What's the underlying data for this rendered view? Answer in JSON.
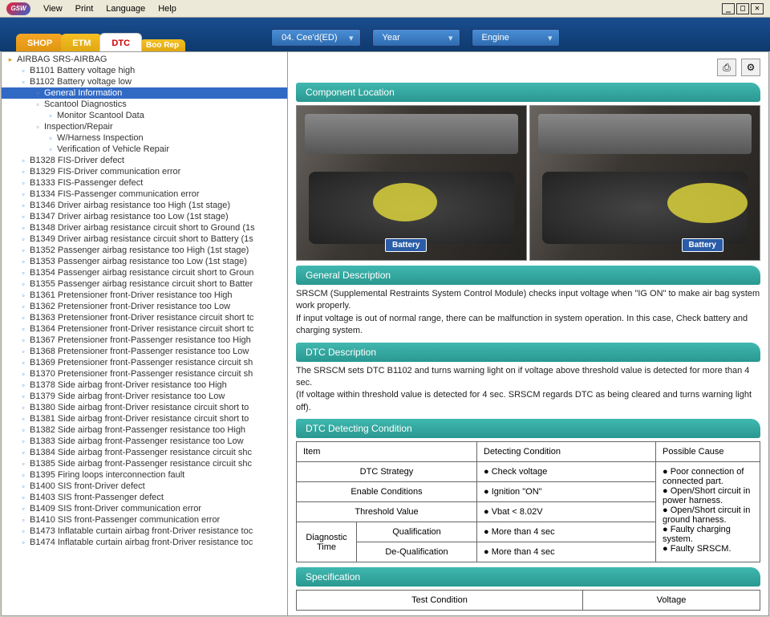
{
  "menu": {
    "view": "View",
    "print": "Print",
    "language": "Language",
    "help": "Help",
    "logo": "GSW"
  },
  "tabs": {
    "shop": "SHOP",
    "etm": "ETM",
    "dtc": "DTC",
    "boo": "Boo\nRep"
  },
  "filters": {
    "model": "04. Cee'd(ED)",
    "year": "Year",
    "engine": "Engine"
  },
  "tree": [
    {
      "l": 0,
      "i": "fold",
      "t": "AIRBAG SRS-AIRBAG"
    },
    {
      "l": 1,
      "i": "doc",
      "t": "B1101 Battery voltage high"
    },
    {
      "l": 1,
      "i": "doc",
      "t": "B1102 Battery voltage low"
    },
    {
      "l": 2,
      "i": "pg",
      "t": "General Information",
      "sel": true
    },
    {
      "l": 2,
      "i": "pg",
      "t": "Scantool Diagnostics"
    },
    {
      "l": 3,
      "i": "doc",
      "t": "Monitor Scantool Data"
    },
    {
      "l": 2,
      "i": "pg",
      "t": "Inspection/Repair"
    },
    {
      "l": 3,
      "i": "doc",
      "t": "W/Harness Inspection"
    },
    {
      "l": 3,
      "i": "doc",
      "t": "Verification of Vehicle Repair"
    },
    {
      "l": 1,
      "i": "doc",
      "t": "B1328 FIS-Driver defect"
    },
    {
      "l": 1,
      "i": "doc",
      "t": "B1329 FIS-Driver communication error"
    },
    {
      "l": 1,
      "i": "doc",
      "t": "B1333 FIS-Passenger defect"
    },
    {
      "l": 1,
      "i": "doc",
      "t": "B1334 FIS-Passenger communication error"
    },
    {
      "l": 1,
      "i": "doc",
      "t": "B1346 Driver airbag resistance too High (1st stage)"
    },
    {
      "l": 1,
      "i": "doc",
      "t": "B1347 Driver airbag resistance too Low (1st stage)"
    },
    {
      "l": 1,
      "i": "doc",
      "t": "B1348 Driver airbag resistance circuit short to Ground (1s"
    },
    {
      "l": 1,
      "i": "doc",
      "t": "B1349 Driver airbag resistance circuit short to Battery (1s"
    },
    {
      "l": 1,
      "i": "doc",
      "t": "B1352 Passenger airbag resistance too High (1st stage)"
    },
    {
      "l": 1,
      "i": "doc",
      "t": "B1353 Passenger airbag resistance too Low (1st stage)"
    },
    {
      "l": 1,
      "i": "doc",
      "t": "B1354 Passenger airbag resistance circuit short to Groun"
    },
    {
      "l": 1,
      "i": "doc",
      "t": "B1355 Passenger airbag resistance circuit short to Batter"
    },
    {
      "l": 1,
      "i": "doc",
      "t": "B1361 Pretensioner front-Driver resistance too High"
    },
    {
      "l": 1,
      "i": "doc",
      "t": "B1362 Pretensioner front-Driver resistance too Low"
    },
    {
      "l": 1,
      "i": "doc",
      "t": "B1363 Pretensioner front-Driver resistance circuit short tc"
    },
    {
      "l": 1,
      "i": "doc",
      "t": "B1364 Pretensioner front-Driver resistance circuit short tc"
    },
    {
      "l": 1,
      "i": "doc",
      "t": "B1367 Pretensioner front-Passenger resistance too High"
    },
    {
      "l": 1,
      "i": "doc",
      "t": "B1368 Pretensioner front-Passenger resistance too Low"
    },
    {
      "l": 1,
      "i": "doc",
      "t": "B1369 Pretensioner front-Passenger resistance circuit sh"
    },
    {
      "l": 1,
      "i": "doc",
      "t": "B1370 Pretensioner front-Passenger resistance circuit sh"
    },
    {
      "l": 1,
      "i": "doc",
      "t": "B1378 Side airbag front-Driver resistance too High"
    },
    {
      "l": 1,
      "i": "doc",
      "t": "B1379 Side airbag front-Driver resistance too Low"
    },
    {
      "l": 1,
      "i": "doc",
      "t": "B1380 Side airbag front-Driver resistance circuit short to"
    },
    {
      "l": 1,
      "i": "doc",
      "t": "B1381 Side airbag front-Driver resistance circuit short to"
    },
    {
      "l": 1,
      "i": "doc",
      "t": "B1382 Side airbag front-Passenger resistance too High"
    },
    {
      "l": 1,
      "i": "doc",
      "t": "B1383 Side airbag front-Passenger resistance too Low"
    },
    {
      "l": 1,
      "i": "doc",
      "t": "B1384 Side airbag front-Passenger resistance circuit shc"
    },
    {
      "l": 1,
      "i": "doc",
      "t": "B1385 Side airbag front-Passenger resistance circuit shc"
    },
    {
      "l": 1,
      "i": "doc",
      "t": "B1395 Firing loops interconnection fault"
    },
    {
      "l": 1,
      "i": "doc",
      "t": "B1400 SIS front-Driver defect"
    },
    {
      "l": 1,
      "i": "doc",
      "t": "B1403 SIS front-Passenger defect"
    },
    {
      "l": 1,
      "i": "doc",
      "t": "B1409 SIS front-Driver communication error"
    },
    {
      "l": 1,
      "i": "doc",
      "t": "B1410 SIS front-Passenger communication error"
    },
    {
      "l": 1,
      "i": "doc",
      "t": "B1473 Inflatable curtain airbag front-Driver resistance toc"
    },
    {
      "l": 1,
      "i": "doc",
      "t": "B1474 Inflatable curtain airbag front-Driver resistance toc"
    }
  ],
  "sections": {
    "comp_loc": "Component Location",
    "gen_desc": "General Description",
    "dtc_desc": "DTC Description",
    "dtc_cond": "DTC Detecting Condition",
    "spec": "Specification"
  },
  "battery_label": "Battery",
  "gen_desc_text": "SRSCM (Supplemental Restraints System Control Module) checks input voltage when \"IG ON\" to make air bag system work properly.\nIf input voltage is out of normal range, there can be malfunction in system operation. In this case, Check battery and charging system.",
  "dtc_desc_text": "The SRSCM sets DTC B1102 and turns warning light on if voltage above threshold value is detected for more than 4 sec.\n(If voltage within threshold value is detected for 4 sec. SRSCM regards DTC as being cleared and turns warning light off).",
  "cond_table": {
    "h1": "Item",
    "h2": "Detecting Condition",
    "h3": "Possible Cause",
    "r1a": "DTC Strategy",
    "r1b": "Check voltage",
    "r2a": "Enable Conditions",
    "r2b": "Ignition \"ON\"",
    "r3a": "Threshold Value",
    "r3b": "Vbat < 8.02V",
    "r4a": "Diagnostic Time",
    "r4b": "Qualification",
    "r4c": "More than 4 sec",
    "r5b": "De-Qualification",
    "r5c": "More than 4 sec",
    "cause": "Poor connection of connected part.|Open/Short circuit in power harness.|Open/Short circuit in ground harness.|Faulty charging system.|Faulty SRSCM."
  },
  "spec_table": {
    "h1": "Test Condition",
    "h2": "Voltage"
  }
}
